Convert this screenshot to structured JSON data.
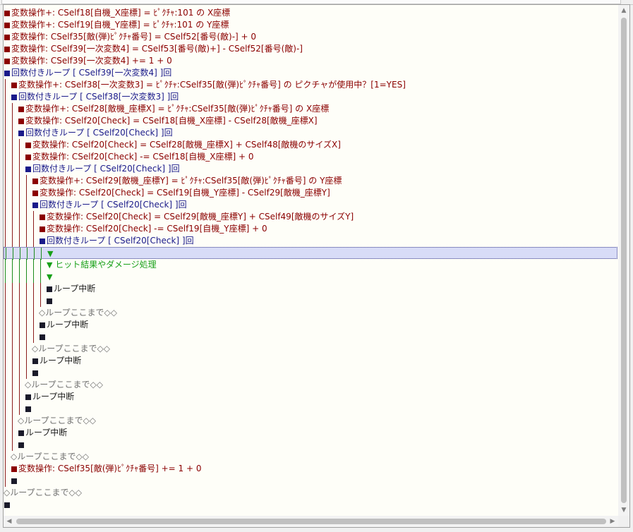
{
  "icons": {
    "up_arrow": "▲",
    "down_arrow": "▼",
    "left_arrow": "◀",
    "right_arrow": "▶"
  },
  "colors": {
    "operation": "#8b0000",
    "loop": "#1a1a8a",
    "comment": "#18a018",
    "selection": "#d8dcf7"
  },
  "lines": [
    {
      "indent": 0,
      "mark": "op",
      "text": "変数操作+: CSelf18[自機_X座標] = ﾋﾟｸﾁｬ:101 の X座標",
      "style": "op"
    },
    {
      "indent": 0,
      "mark": "op",
      "text": "変数操作+: CSelf19[自機_Y座標] = ﾋﾟｸﾁｬ:101 の Y座標",
      "style": "op"
    },
    {
      "indent": 0,
      "mark": "op",
      "text": "変数操作: CSelf35[敵(弾)ﾋﾟｸﾁｬ番号] = CSelf52[番号(敵)-] + 0",
      "style": "op"
    },
    {
      "indent": 0,
      "mark": "op",
      "text": "変数操作: CSelf39[一次変数4] = CSelf53[番号(敵)+] - CSelf52[番号(敵)-]",
      "style": "op"
    },
    {
      "indent": 0,
      "mark": "op",
      "text": "変数操作: CSelf39[一次変数4] += 1 + 0",
      "style": "op"
    },
    {
      "indent": 0,
      "mark": "loop",
      "text": "回数付きループ [ CSelf39[一次変数4] ]回",
      "style": "loop"
    },
    {
      "indent": 1,
      "mark": "op",
      "text": "変数操作+: CSelf38[一次変数3] = ﾋﾟｸﾁｬ:CSelf35[敵(弾)ﾋﾟｸﾁｬ番号] の ピクチャが使用中？[1=YES]",
      "style": "op"
    },
    {
      "indent": 1,
      "mark": "loop",
      "text": "回数付きループ [ CSelf38[一次変数3] ]回",
      "style": "loop"
    },
    {
      "indent": 2,
      "mark": "op",
      "text": "変数操作+: CSelf28[敵機_座標X] = ﾋﾟｸﾁｬ:CSelf35[敵(弾)ﾋﾟｸﾁｬ番号] の X座標",
      "style": "op"
    },
    {
      "indent": 2,
      "mark": "op",
      "text": "変数操作: CSelf20[Check] = CSelf18[自機_X座標] - CSelf28[敵機_座標X]",
      "style": "op"
    },
    {
      "indent": 2,
      "mark": "loop",
      "text": "回数付きループ [ CSelf20[Check] ]回",
      "style": "loop"
    },
    {
      "indent": 3,
      "mark": "op",
      "text": "変数操作: CSelf20[Check] = CSelf28[敵機_座標X] + CSelf48[敵機のサイズX]",
      "style": "op"
    },
    {
      "indent": 3,
      "mark": "op",
      "text": "変数操作: CSelf20[Check] -= CSelf18[自機_X座標] + 0",
      "style": "op"
    },
    {
      "indent": 3,
      "mark": "loop",
      "text": "回数付きループ [ CSelf20[Check] ]回",
      "style": "loop"
    },
    {
      "indent": 4,
      "mark": "op",
      "text": "変数操作+: CSelf29[敵機_座標Y] = ﾋﾟｸﾁｬ:CSelf35[敵(弾)ﾋﾟｸﾁｬ番号] の Y座標",
      "style": "op"
    },
    {
      "indent": 4,
      "mark": "op",
      "text": "変数操作: CSelf20[Check] = CSelf19[自機_Y座標] - CSelf29[敵機_座標Y]",
      "style": "op"
    },
    {
      "indent": 4,
      "mark": "loop",
      "text": "回数付きループ [ CSelf20[Check] ]回",
      "style": "loop"
    },
    {
      "indent": 5,
      "mark": "op",
      "text": "変数操作: CSelf20[Check] = CSelf29[敵機_座標Y] + CSelf49[敵機のサイズY]",
      "style": "op"
    },
    {
      "indent": 5,
      "mark": "op",
      "text": "変数操作: CSelf20[Check] -= CSelf19[自機_Y座標] + 0",
      "style": "op"
    },
    {
      "indent": 5,
      "mark": "loop",
      "text": "回数付きループ [ CSelf20[Check] ]回",
      "style": "loop"
    },
    {
      "indent": 6,
      "mark": "arrow",
      "text": "",
      "style": "green",
      "selected": true
    },
    {
      "indent": 6,
      "mark": "arrow",
      "text": "ヒット結果やダメージ処理",
      "style": "green"
    },
    {
      "indent": 6,
      "mark": "arrow",
      "text": "",
      "style": "green"
    },
    {
      "indent": 6,
      "mark": "end",
      "text": "ループ中断",
      "style": "plain"
    },
    {
      "indent": 6,
      "mark": "end",
      "text": "",
      "style": "plain"
    },
    {
      "indent": 5,
      "mark": "none",
      "text": "◇ループここまで◇◇",
      "style": "gray"
    },
    {
      "indent": 5,
      "mark": "end",
      "text": "ループ中断",
      "style": "plain"
    },
    {
      "indent": 5,
      "mark": "end",
      "text": "",
      "style": "plain"
    },
    {
      "indent": 4,
      "mark": "none",
      "text": "◇ループここまで◇◇",
      "style": "gray"
    },
    {
      "indent": 4,
      "mark": "end",
      "text": "ループ中断",
      "style": "plain"
    },
    {
      "indent": 4,
      "mark": "end",
      "text": "",
      "style": "plain"
    },
    {
      "indent": 3,
      "mark": "none",
      "text": "◇ループここまで◇◇",
      "style": "gray"
    },
    {
      "indent": 3,
      "mark": "end",
      "text": "ループ中断",
      "style": "plain"
    },
    {
      "indent": 3,
      "mark": "end",
      "text": "",
      "style": "plain"
    },
    {
      "indent": 2,
      "mark": "none",
      "text": "◇ループここまで◇◇",
      "style": "gray"
    },
    {
      "indent": 2,
      "mark": "end",
      "text": "ループ中断",
      "style": "plain"
    },
    {
      "indent": 2,
      "mark": "end",
      "text": "",
      "style": "plain"
    },
    {
      "indent": 1,
      "mark": "none",
      "text": "◇ループここまで◇◇",
      "style": "gray"
    },
    {
      "indent": 1,
      "mark": "op",
      "text": "変数操作: CSelf35[敵(弾)ﾋﾟｸﾁｬ番号] += 1 + 0",
      "style": "op"
    },
    {
      "indent": 1,
      "mark": "end",
      "text": "",
      "style": "plain"
    },
    {
      "indent": 0,
      "mark": "none",
      "text": "◇ループここまで◇◇",
      "style": "gray"
    },
    {
      "indent": 0,
      "mark": "end",
      "text": "",
      "style": "plain"
    }
  ]
}
